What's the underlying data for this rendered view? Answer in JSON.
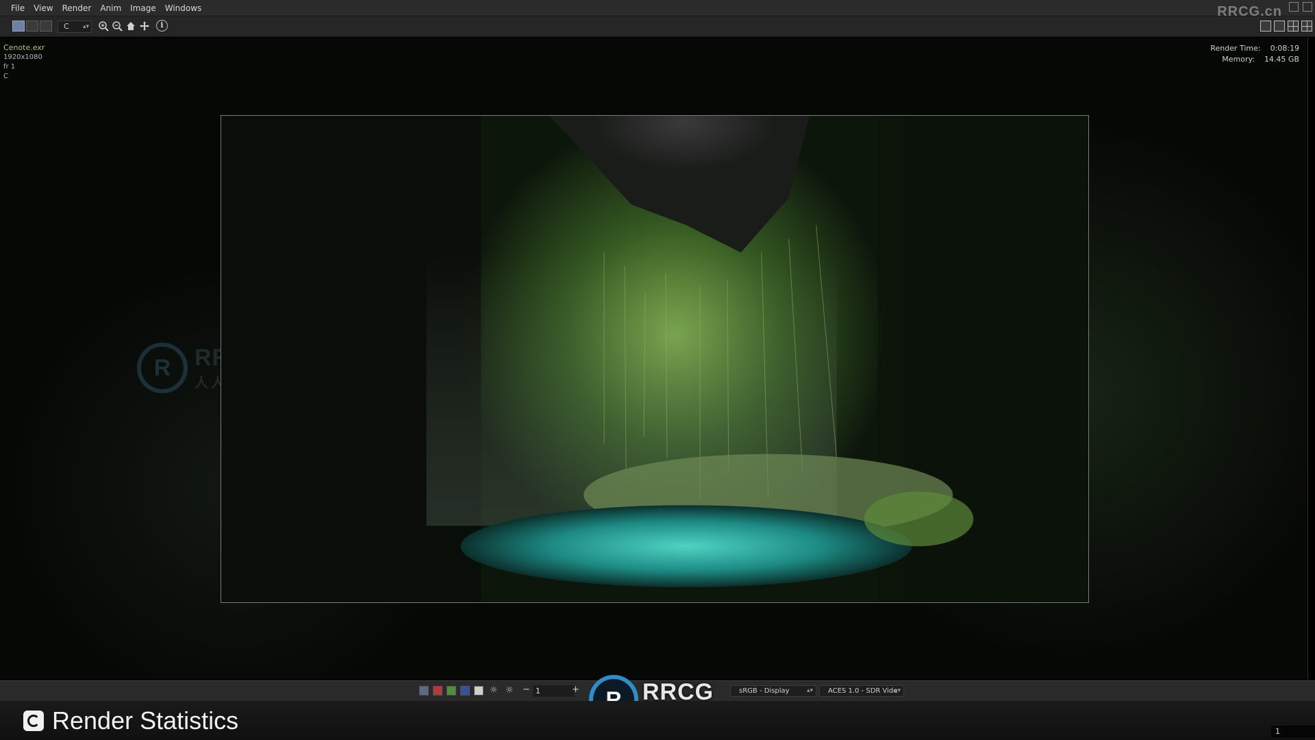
{
  "menubar": {
    "items": [
      "File",
      "View",
      "Render",
      "Anim",
      "Image",
      "Windows"
    ],
    "corner_logo": "RRCG.cn"
  },
  "toolbar": {
    "channel_value": "C",
    "icons": [
      "single-view-icon",
      "split-view-icon",
      "display-icon",
      "zoom-in-icon",
      "zoom-out-icon",
      "home-icon",
      "pan-icon",
      "info-icon"
    ]
  },
  "viewport": {
    "file_name": "Cenote.exr",
    "resolution": "1920x1080",
    "frame": "fr 1",
    "channel": "C",
    "render_time_label": "Render Time:",
    "render_time_value": "0:08:19",
    "memory_label": "Memory:",
    "memory_value": "14.45 GB"
  },
  "watermark": {
    "brand": "RRCG",
    "sub": "人人素材",
    "badge": "R"
  },
  "bottombar": {
    "exposure_value": "1",
    "minus": "−",
    "plus": "+",
    "display_transform": "sRGB - Display",
    "view_transform": "ACES 1.0 - SDR Vide"
  },
  "footer": {
    "title": "Render Statistics",
    "frame_number": "1"
  },
  "colors": {
    "accent": "#6d7fa2",
    "file_name": "#a7c96b",
    "watermark_blue": "#2e8cc8"
  }
}
